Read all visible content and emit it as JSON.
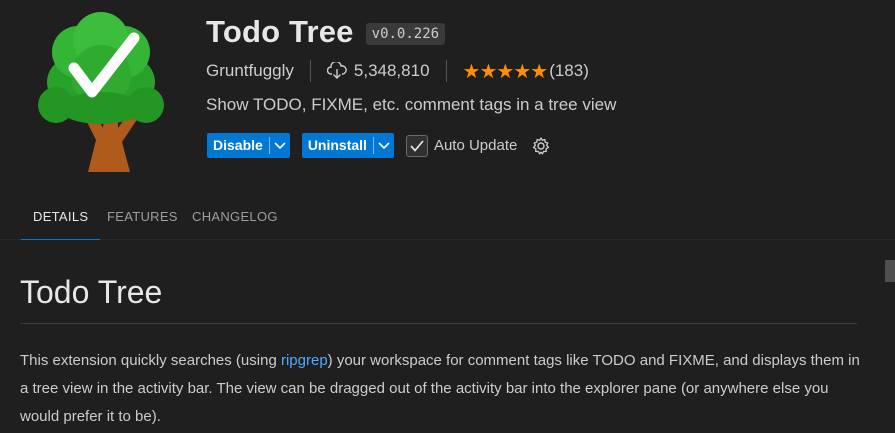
{
  "extension": {
    "title": "Todo Tree",
    "version": "v0.0.226",
    "publisher": "Gruntfuggly",
    "downloads": "5,348,810",
    "rating_stars": 5,
    "rating_count": "(183)",
    "description": "Show TODO, FIXME, etc. comment tags in a tree view",
    "logo_icon": "tree-checkmark-icon"
  },
  "actions": {
    "disable_label": "Disable",
    "uninstall_label": "Uninstall",
    "auto_update_label": "Auto Update",
    "auto_update_checked": true
  },
  "tabs": [
    {
      "label": "DETAILS",
      "active": true
    },
    {
      "label": "FEATURES",
      "active": false
    },
    {
      "label": "CHANGELOG",
      "active": false
    }
  ],
  "content": {
    "heading": "Todo Tree",
    "para_part1": "This extension quickly searches (using ",
    "para_link": "ripgrep",
    "para_part2": ") your workspace for comment tags like TODO and FIXME, and displays them in a tree view in the activity bar. The view can be dragged out of the activity bar into the explorer pane (or anywhere else you would prefer it to be)."
  },
  "colors": {
    "background": "#1f1f1f",
    "accent": "#0078d4",
    "star": "#ff8e00",
    "link": "#4daafc"
  }
}
